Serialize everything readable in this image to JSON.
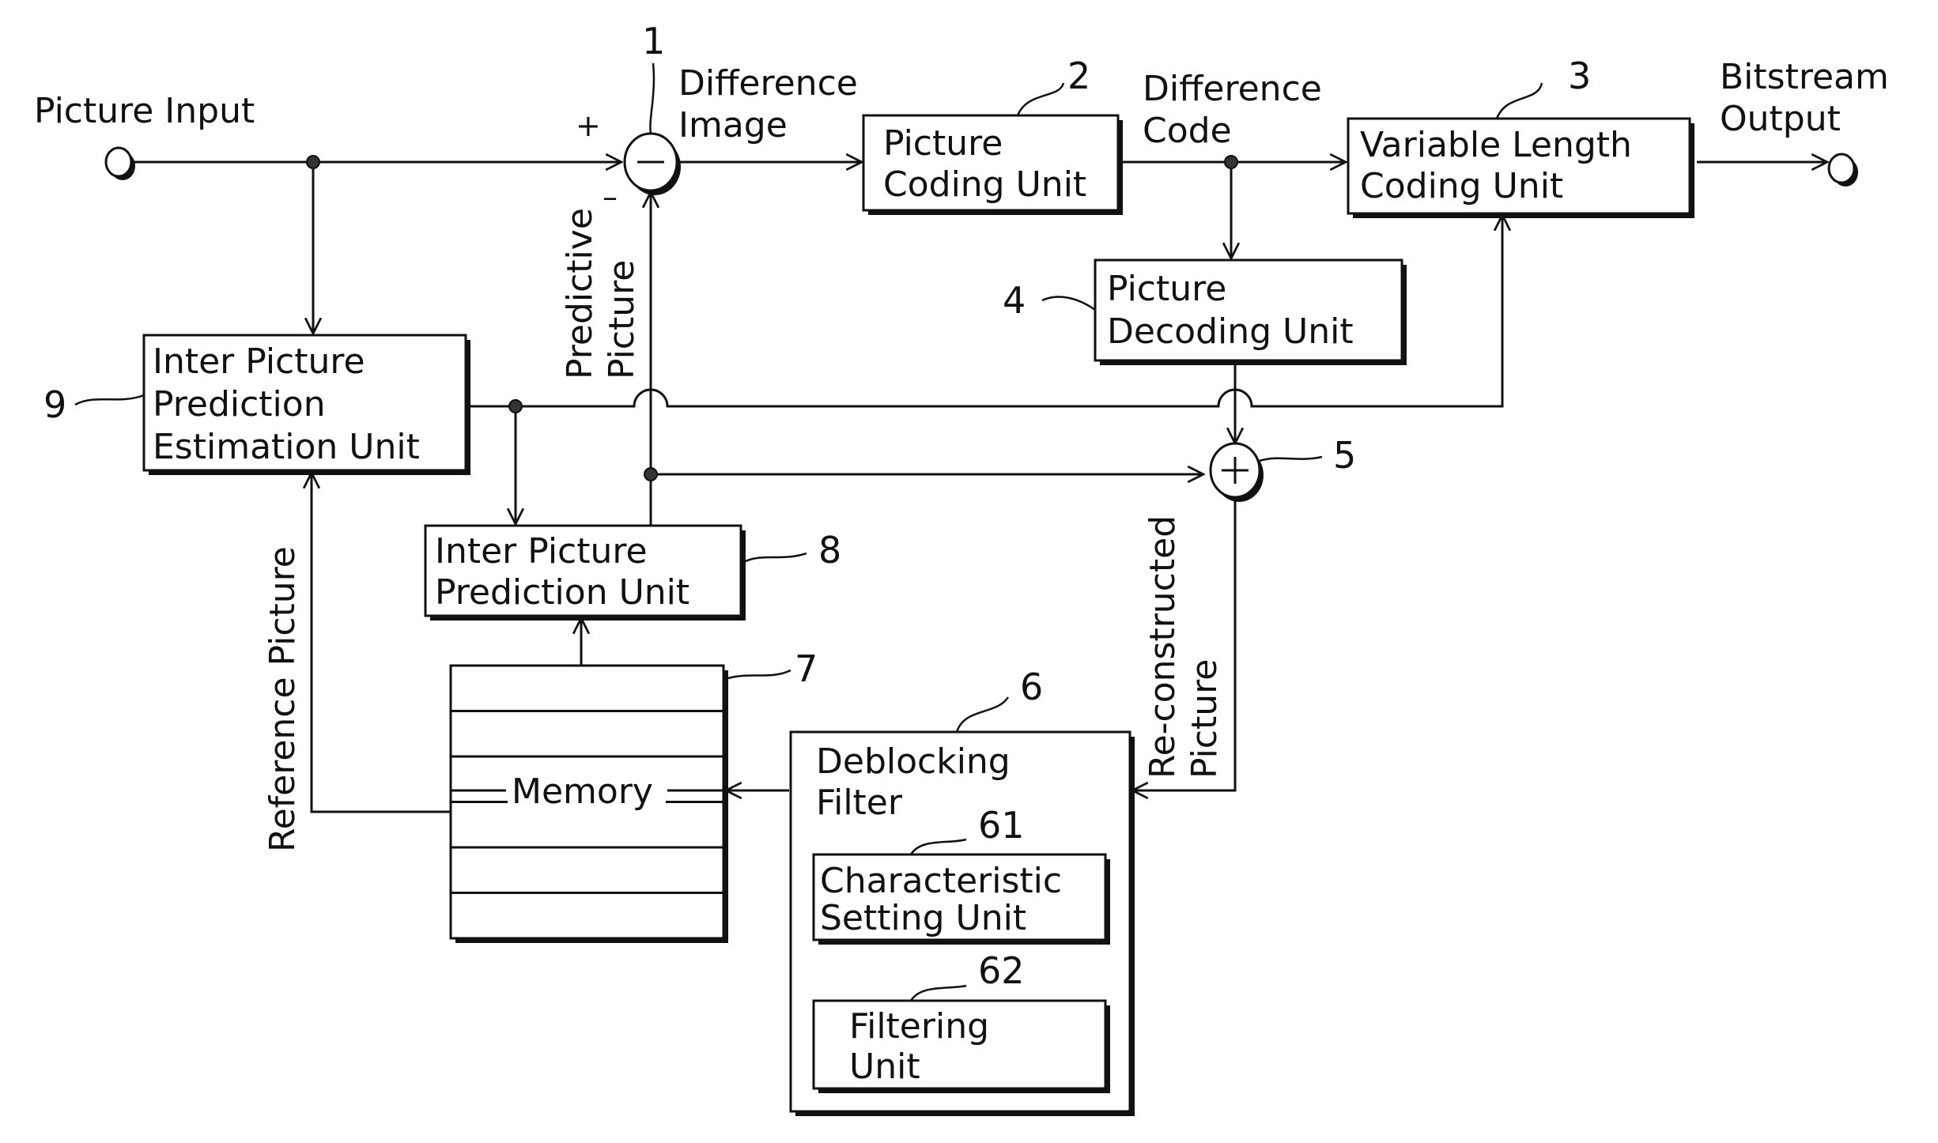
{
  "figure": {
    "io": {
      "input_label": "Picture Input",
      "output_label_line1": "Bitstream",
      "output_label_line2": "Output"
    },
    "signals": {
      "difference_image_line1": "Difference",
      "difference_image_line2": "Image",
      "difference_code_line1": "Difference",
      "difference_code_line2": "Code",
      "predictive_picture_line1": "Predictive",
      "predictive_picture_line2": "Picture",
      "reference_picture": "Reference Picture",
      "reconstructed_picture_line1": "Re-constructed",
      "reconstructed_picture_line2": "Picture",
      "plus_sign": "+",
      "minus_sign": "–"
    },
    "blocks": {
      "subtractor": {
        "ref": "1",
        "symbol": "−"
      },
      "picture_coding_unit": {
        "ref": "2",
        "line1": "Picture",
        "line2": "Coding Unit"
      },
      "variable_length_coding_unit": {
        "ref": "3",
        "line1": "Variable Length",
        "line2": "Coding Unit"
      },
      "picture_decoding_unit": {
        "ref": "4",
        "line1": "Picture",
        "line2": "Decoding Unit"
      },
      "adder": {
        "ref": "5",
        "symbol": "+"
      },
      "deblocking_filter": {
        "ref": "6",
        "line1": "Deblocking",
        "line2": "Filter"
      },
      "characteristic_setting_unit": {
        "ref": "61",
        "line1": "Characteristic",
        "line2": "Setting Unit"
      },
      "filtering_unit": {
        "ref": "62",
        "line1": "Filtering",
        "line2": "Unit"
      },
      "memory": {
        "ref": "7",
        "label": "Memory",
        "slots": 6
      },
      "inter_picture_prediction_unit": {
        "ref": "8",
        "line1": "Inter Picture",
        "line2": "Prediction Unit"
      },
      "inter_picture_prediction_estimation_unit": {
        "ref": "9",
        "line1": "Inter Picture",
        "line2": "Prediction",
        "line3": "Estimation Unit"
      }
    }
  }
}
